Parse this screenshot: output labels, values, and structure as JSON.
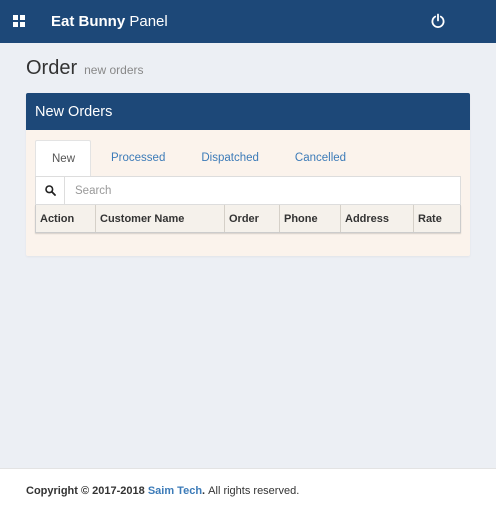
{
  "topbar": {
    "brand_bold": "Eat Bunny",
    "brand_rest": " Panel",
    "menu_icon": "grid-icon",
    "power_icon": "power-icon"
  },
  "page": {
    "title": "Order",
    "subtitle": "new orders"
  },
  "panel": {
    "heading": "New Orders",
    "tabs": [
      {
        "label": "New",
        "active": true
      },
      {
        "label": "Processed",
        "active": false
      },
      {
        "label": "Dispatched",
        "active": false
      },
      {
        "label": "Cancelled",
        "active": false
      }
    ],
    "search": {
      "placeholder": "Search",
      "icon": "search-icon"
    },
    "table": {
      "columns": [
        "Action",
        "Customer Name",
        "Order",
        "Phone",
        "Address",
        "Rate"
      ]
    }
  },
  "footer": {
    "copyright": "Copyright © 2017-2018 ",
    "company": "Saim Tech",
    "rights": ". All rights reserved."
  },
  "colors": {
    "header_bg": "#1d4878",
    "link": "#3c7bb8",
    "panel_bg": "#fbf3ec",
    "page_bg": "#eceff4"
  }
}
